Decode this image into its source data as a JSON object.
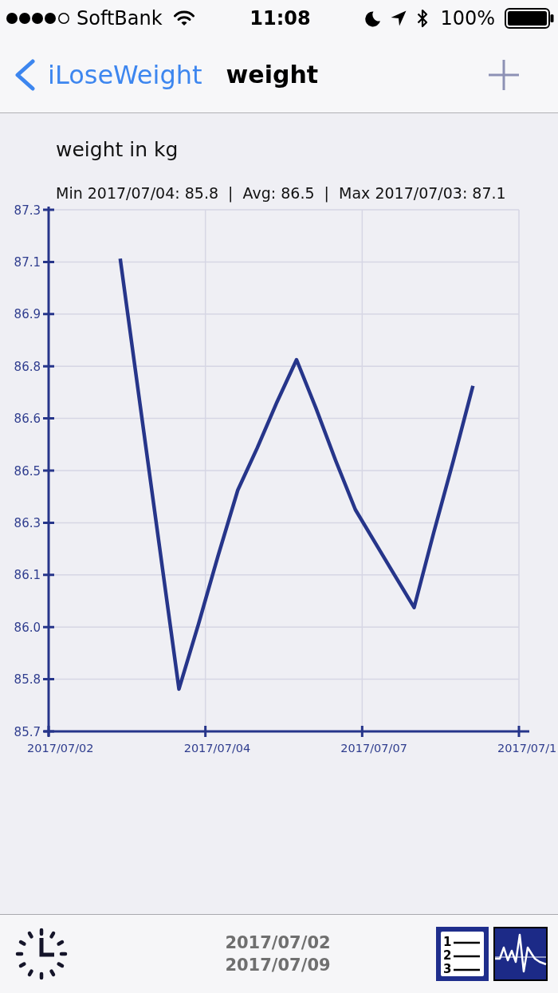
{
  "status_bar": {
    "carrier": "SoftBank",
    "time": "11:08",
    "battery": "100%"
  },
  "nav_bar": {
    "back": "iLoseWeight",
    "title": "weight"
  },
  "chart": {
    "summary": "Min 2017/07/04: 85.8  |  Avg: 86.5  |  Max 2017/07/03: 87.1",
    "chart_data": {
      "type": "line",
      "title": "weight in kg",
      "grid": true,
      "categories": [
        "2017/07/02",
        null,
        null,
        null,
        null,
        null,
        null,
        null,
        "2017/07/04",
        null,
        null,
        null,
        null,
        null,
        null,
        null,
        "2017/07/07",
        null,
        null,
        null,
        null,
        null,
        null,
        null,
        "2017/07/1"
      ],
      "series": [
        {
          "color": "#26358a",
          "values": [
            null,
            null,
            null,
            87.11,
            86.67,
            86.23,
            85.79,
            85.99,
            86.2,
            86.4,
            86.53,
            86.67,
            86.8,
            86.65,
            86.49,
            86.34,
            86.24,
            86.14,
            86.04,
            86.27,
            86.49,
            86.72,
            null,
            null,
            null
          ]
        }
      ],
      "ylim": [
        85.66,
        87.26
      ],
      "yticks": [
        {
          "value": 85.66,
          "label": "85.7"
        },
        {
          "value": 85.82,
          "label": "85.8"
        },
        {
          "value": 85.98,
          "label": "86.0"
        },
        {
          "value": 86.14,
          "label": "86.1"
        },
        {
          "value": 86.3,
          "label": "86.3"
        },
        {
          "value": 86.46,
          "label": "86.5"
        },
        {
          "value": 86.62,
          "label": "86.6"
        },
        {
          "value": 86.78,
          "label": "86.8"
        },
        {
          "value": 86.94,
          "label": "86.9"
        },
        {
          "value": 87.1,
          "label": "87.1"
        },
        {
          "value": 87.26,
          "label": "87.3"
        }
      ]
    }
  },
  "toolbar": {
    "date_range": [
      "2017/07/02",
      "2017/07/09"
    ],
    "list_numbers": [
      "1",
      "2",
      "3"
    ]
  }
}
